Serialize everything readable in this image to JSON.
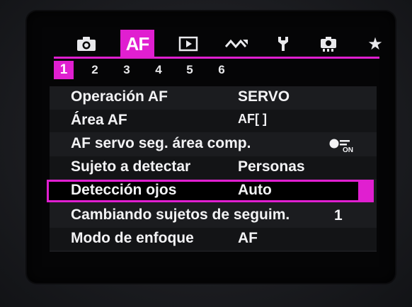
{
  "tabs": [
    {
      "name": "camera-icon",
      "label": ""
    },
    {
      "name": "af",
      "label": "AF"
    },
    {
      "name": "playback-icon",
      "label": ""
    },
    {
      "name": "wireless-icon",
      "label": ""
    },
    {
      "name": "wrench-icon",
      "label": ""
    },
    {
      "name": "custom-camera-icon",
      "label": ""
    },
    {
      "name": "star-icon",
      "label": "★"
    }
  ],
  "subtabs": [
    "1",
    "2",
    "3",
    "4",
    "5",
    "6"
  ],
  "active_subtab": "1",
  "menu": [
    {
      "label": "Operación AF",
      "value": "SERVO"
    },
    {
      "label": "Área AF",
      "value": "AF[ ]"
    },
    {
      "label": "AF servo seg. área comp.",
      "value": "ON"
    },
    {
      "label": "Sujeto a detectar",
      "value": "Personas"
    },
    {
      "label": "Detección ojos",
      "value": "Auto"
    },
    {
      "label": "Cambiando sujetos de seguim.",
      "value": "1"
    },
    {
      "label": "Modo de enfoque",
      "value": "AF"
    }
  ],
  "colors": {
    "accent": "#e01fd0",
    "background": "#050506",
    "text": "#f3f3f5"
  }
}
